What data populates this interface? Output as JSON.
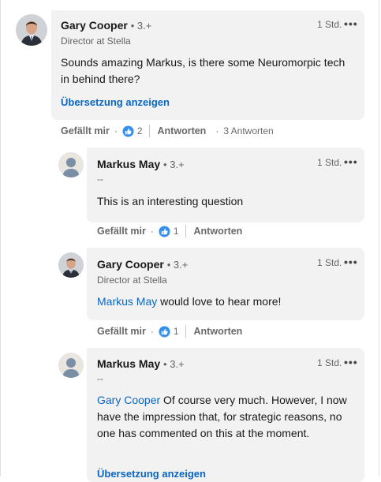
{
  "comment": {
    "name": "Gary Cooper",
    "degree": "• 3.+",
    "headline": "Director at Stella",
    "time": "1 Std.",
    "more": "•••",
    "text": "Sounds amazing Markus, is there some Neuromorpic tech in behind there?",
    "translate": "Übersetzung anzeigen",
    "like_label": "Gefällt mir",
    "reaction_count": "2",
    "reply_label": "Antworten",
    "replies_count": "3 Antworten"
  },
  "replies": [
    {
      "name": "Markus May",
      "degree": "• 3.+",
      "headline": "--",
      "time": "1 Std.",
      "more": "•••",
      "text": "This is an interesting question",
      "like_label": "Gefällt mir",
      "reaction_count": "1",
      "reply_label": "Antworten"
    },
    {
      "name": "Gary Cooper",
      "degree": "• 3.+",
      "headline": "Director at Stella",
      "time": "1 Std.",
      "more": "•••",
      "mention": "Markus May",
      "text": " would love to hear more!",
      "like_label": "Gefällt mir",
      "reaction_count": "1",
      "reply_label": "Antworten"
    },
    {
      "name": "Markus May",
      "degree": "• 3.+",
      "headline": "--",
      "time": "1 Std.",
      "more": "•••",
      "mention": "Gary Cooper",
      "text": " Of course very much. However, I now have the impression that, for strategic reasons, no one has commented on this at the moment.",
      "translate": "Übersetzung anzeigen"
    }
  ],
  "colors": {
    "link": "#0a66c2",
    "bubble": "#f2f2f2"
  },
  "icons": {
    "reaction": "like-reaction-icon",
    "more": "more-options-icon"
  }
}
